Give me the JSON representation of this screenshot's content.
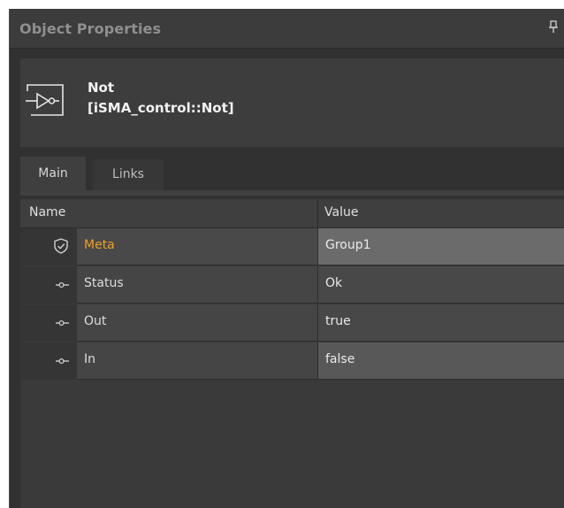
{
  "panel": {
    "title": "Object Properties",
    "pin_icon": "pin-icon"
  },
  "component": {
    "icon": "not-gate-icon",
    "name": "Not",
    "type": "[iSMA_control::Not]"
  },
  "tabs": [
    {
      "label": "Main",
      "active": true
    },
    {
      "label": "Links",
      "active": false
    }
  ],
  "grid": {
    "columns": {
      "name": "Name",
      "value": "Value"
    },
    "rows": [
      {
        "icon": "shield-check-icon",
        "name": "Meta",
        "value": "Group1",
        "highlight": "#f0a020"
      },
      {
        "icon": "slot-connector-icon",
        "name": "Status",
        "value": "Ok"
      },
      {
        "icon": "slot-connector-icon",
        "name": "Out",
        "value": "true"
      },
      {
        "icon": "slot-connector-icon",
        "name": "In",
        "value": "false"
      }
    ]
  },
  "colors": {
    "background": "#313131",
    "accent_meta": "#f0a020",
    "text": "#dedede"
  }
}
